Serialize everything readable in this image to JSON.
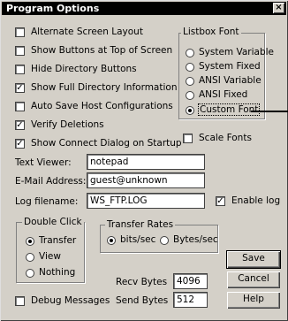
{
  "title": "Program Options",
  "close_glyph": "×",
  "options": [
    {
      "label": "Alternate Screen Layout",
      "checked": false
    },
    {
      "label": "Show Buttons at Top of Screen",
      "checked": false
    },
    {
      "label": "Hide Directory Buttons",
      "checked": false
    },
    {
      "label": "Show Full Directory Information",
      "checked": true
    },
    {
      "label": "Auto Save Host Configurations",
      "checked": false
    },
    {
      "label": "Verify Deletions",
      "checked": true
    },
    {
      "label": "Show Connect Dialog on Startup",
      "checked": true
    }
  ],
  "listbox_font": {
    "title": "Listbox Font",
    "choices": [
      "System Variable",
      "System Fixed",
      "ANSI Variable",
      "ANSI Fixed",
      "Custom Font"
    ],
    "selected": "Custom Font"
  },
  "scale_fonts": {
    "label": "Scale Fonts",
    "checked": false
  },
  "fields": {
    "text_viewer": {
      "label": "Text Viewer:",
      "value": "notepad"
    },
    "email": {
      "label": "E-Mail Address:",
      "value": "guest@unknown"
    },
    "log_filename": {
      "label": "Log filename:",
      "value": "WS_FTP.LOG"
    }
  },
  "enable_log": {
    "label": "Enable log",
    "checked": true
  },
  "double_click": {
    "title": "Double Click",
    "choices": [
      "Transfer",
      "View",
      "Nothing"
    ],
    "selected": "Transfer"
  },
  "transfer_rates": {
    "title": "Transfer Rates",
    "choices": [
      "bits/sec",
      "Bytes/sec"
    ],
    "selected": "bits/sec"
  },
  "recv_bytes": {
    "label": "Recv Bytes",
    "value": "4096"
  },
  "send_bytes": {
    "label": "Send Bytes",
    "value": "512"
  },
  "debug_messages": {
    "label": "Debug Messages",
    "checked": false
  },
  "buttons": {
    "save": "Save",
    "cancel": "Cancel",
    "help": "Help"
  }
}
